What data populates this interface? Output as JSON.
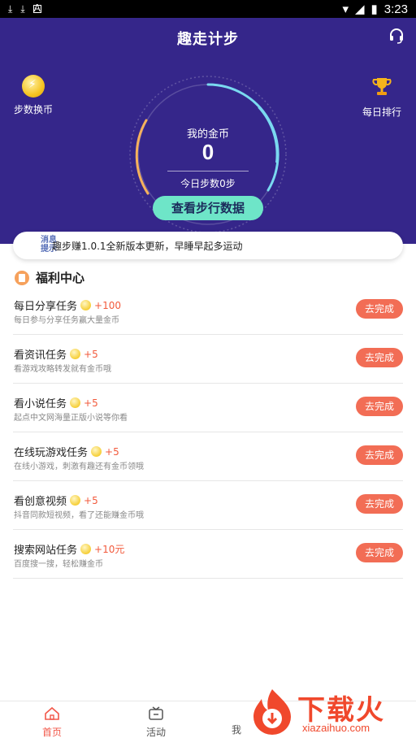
{
  "status_bar": {
    "time": "3:23",
    "icons_left": [
      "download-icon",
      "download-icon",
      "a-icon"
    ],
    "icons_right": [
      "wifi-icon",
      "signal-icon",
      "battery-icon"
    ]
  },
  "header": {
    "title": "趣走计步",
    "support_icon": "headset-icon"
  },
  "actions": {
    "left": {
      "label": "步数换币",
      "icon": "coin-lightning-icon"
    },
    "right": {
      "label": "每日排行",
      "icon": "trophy-icon"
    }
  },
  "gauge": {
    "coin_label": "我的金币",
    "coin_value": "0",
    "steps_label": "今日步数0步",
    "button_label": "查看步行数据",
    "colors": {
      "track": "#7ad9f0",
      "accent": "#f5b15c",
      "background": "#35268a"
    }
  },
  "notice": {
    "badge_line1": "消息",
    "badge_line2": "提示",
    "text": "趣步赚1.0.1全新版本更新，早睡早起多运动"
  },
  "section": {
    "title": "福利中心"
  },
  "tasks": [
    {
      "title": "每日分享任务",
      "reward": "+100",
      "desc": "每日参与分享任务赢大量金币",
      "button": "去完成"
    },
    {
      "title": "看资讯任务",
      "reward": "+5",
      "desc": "看游戏攻略转发就有金币哦",
      "button": "去完成"
    },
    {
      "title": "看小说任务",
      "reward": "+5",
      "desc": "起点中文网海量正版小说等你看",
      "button": "去完成"
    },
    {
      "title": "在线玩游戏任务",
      "reward": "+5",
      "desc": "在线小游戏，刺激有趣还有金币领哦",
      "button": "去完成"
    },
    {
      "title": "看创意视频",
      "reward": "+5",
      "desc": "抖音同款短视频，看了还能赚金币哦",
      "button": "去完成"
    },
    {
      "title": "搜索网站任务",
      "reward": "+10元",
      "desc": "百度搜一搜，轻松赚金币",
      "button": "去完成"
    }
  ],
  "bottom_nav": [
    {
      "label": "首页",
      "icon": "home-icon",
      "active": true
    },
    {
      "label": "活动",
      "icon": "activity-icon",
      "active": false
    },
    {
      "label": "我",
      "icon": "profile-icon",
      "active": false
    }
  ],
  "watermark": {
    "brand": "下载火",
    "url": "xiazaihuo.com"
  },
  "colors": {
    "primary": "#35268a",
    "task_button": "#f26d55",
    "reward": "#f25a3c",
    "nav_active": "#f2584a"
  }
}
